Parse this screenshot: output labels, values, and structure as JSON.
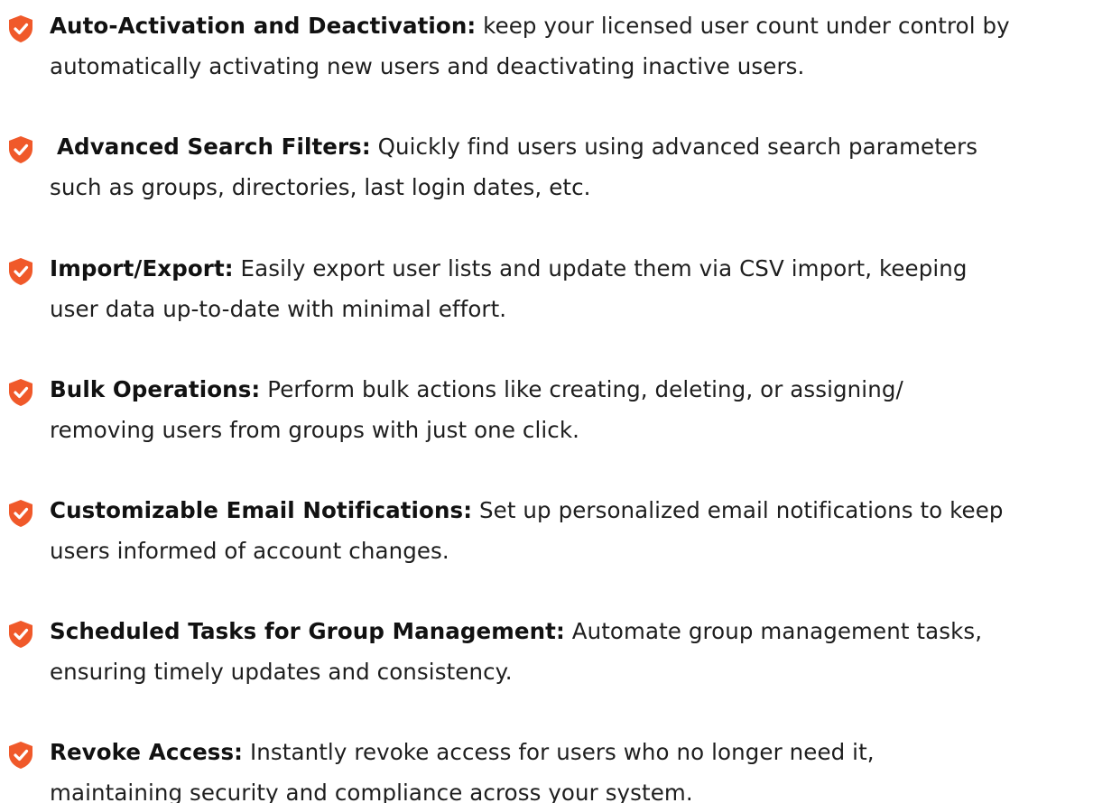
{
  "accent_color": "#f0592a",
  "features": [
    {
      "icon": "shield-check-icon",
      "title": "Auto-Activation and Deactivation:",
      "line1": " keep your licensed user count under control by",
      "line2": "automatically activating new users and deactivating inactive users."
    },
    {
      "icon": "shield-check-icon",
      "title": "Advanced Search Filters:",
      "line1": " Quickly find users using advanced search parameters",
      "line2": "such as groups, directories, last login dates, etc."
    },
    {
      "icon": "shield-check-icon",
      "title": "Import/Export:",
      "line1": " Easily export user lists and update them via CSV import, keeping",
      "line2": "user data up-to-date with minimal effort."
    },
    {
      "icon": "shield-check-icon",
      "title": "Bulk Operations:",
      "line1": " Perform bulk actions like creating, deleting, or assigning/",
      "line2": "removing users from groups with just one click."
    },
    {
      "icon": "shield-check-icon",
      "title": "Customizable Email Notifications:",
      "line1": " Set up personalized email notifications to keep",
      "line2": "users informed of account changes."
    },
    {
      "icon": "shield-check-icon",
      "title": "Scheduled Tasks for Group Management:",
      "line1": " Automate group management tasks,",
      "line2": "ensuring timely updates and consistency."
    },
    {
      "icon": "shield-check-icon",
      "title": "Revoke Access:",
      "line1": " Instantly revoke access for users who no longer need it,",
      "line2": "maintaining security and compliance across your system."
    }
  ]
}
